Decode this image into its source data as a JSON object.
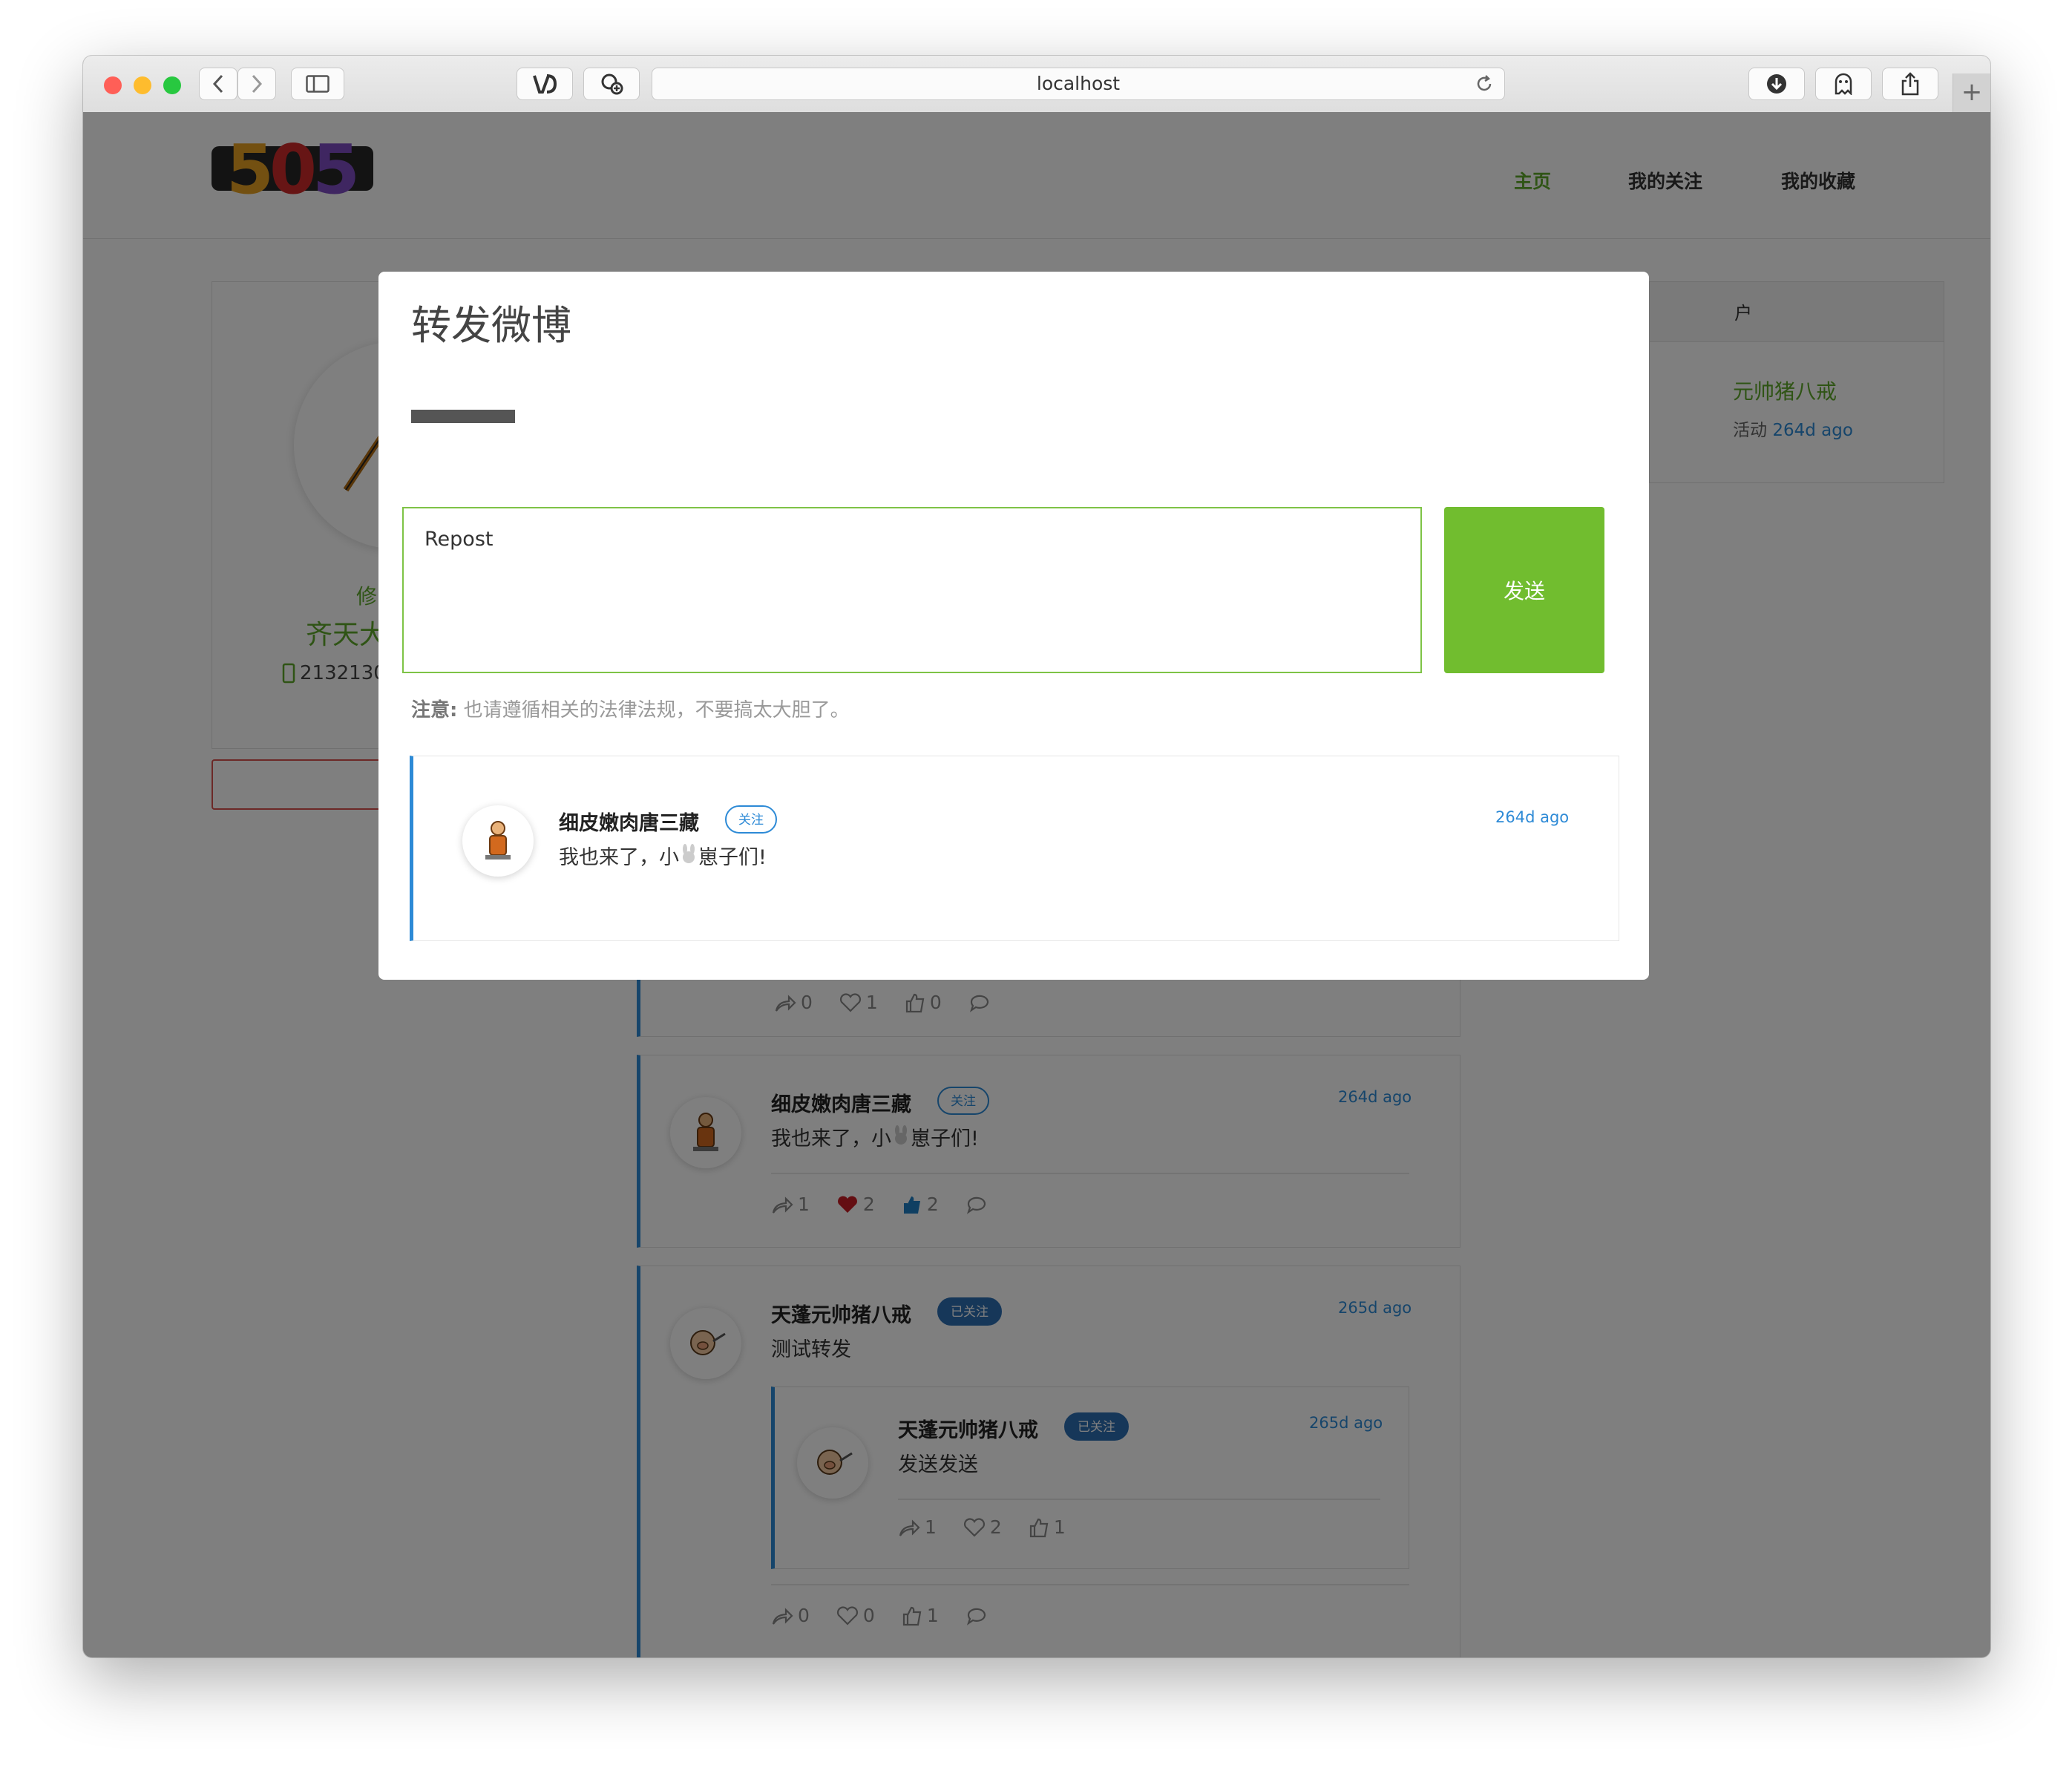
{
  "browser": {
    "url": "localhost",
    "traffic_lights": [
      "#ff5f57",
      "#febc2e",
      "#28c840"
    ]
  },
  "site": {
    "logo_text": "505",
    "nav": [
      {
        "label": "主页",
        "active": true
      },
      {
        "label": "我的关注",
        "active": false
      },
      {
        "label": "我的收藏",
        "active": false
      }
    ],
    "accent_color": "#5ea82a",
    "link_color": "#2d8ad6"
  },
  "profile": {
    "edit_label": "修",
    "name": "齐天大",
    "phone": "2132130"
  },
  "sidebar": {
    "header": "户",
    "user_name": "元帅猪八戒",
    "activity_label": "活动",
    "activity_time": "264d ago"
  },
  "feed": [
    {
      "actions": {
        "repost": "0",
        "like": "1",
        "thumb": "0"
      }
    },
    {
      "user": "细皮嫩肉唐三藏",
      "badge": "关注",
      "text_before": "我也来了，小",
      "text_after": "崽子们!",
      "time": "264d ago",
      "actions": {
        "repost": "1",
        "like": "2",
        "thumb": "2"
      }
    },
    {
      "user": "天蓬元帅猪八戒",
      "badge": "已关注",
      "text": "测试转发",
      "time": "265d ago",
      "quoted": {
        "user": "天蓬元帅猪八戒",
        "badge": "已关注",
        "text": "发送发送",
        "time": "265d ago",
        "actions": {
          "repost": "1",
          "like": "2",
          "thumb": "1"
        }
      },
      "actions": {
        "repost": "0",
        "like": "0",
        "thumb": "1"
      }
    }
  ],
  "modal": {
    "title": "转发微博",
    "textarea_value": "Repost",
    "send_label": "发送",
    "notice_label": "注意:",
    "notice_text": " 也请遵循相关的法律法规，不要搞太大胆了。",
    "quoted": {
      "user": "细皮嫩肉唐三藏",
      "badge": "关注",
      "text_before": "我也来了，小",
      "text_after": "崽子们!",
      "time": "264d ago"
    }
  }
}
